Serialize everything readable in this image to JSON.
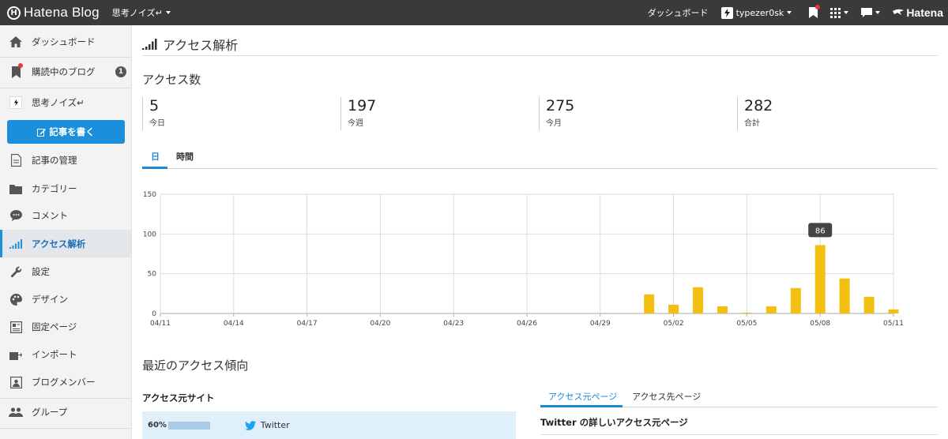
{
  "topbar": {
    "logo_text": "Hatena Blog",
    "logo_mark": "H",
    "blog_name": "思考ノイズ↵",
    "dashboard_label": "ダッシュボード",
    "user_name": "typezer0sk",
    "hatena_label": "Hatena"
  },
  "sidebar": {
    "items": [
      {
        "label": "ダッシュボード",
        "icon": "home-icon"
      },
      {
        "label": "購読中のブログ",
        "icon": "bookmark-icon",
        "badge": "1"
      },
      {
        "label": "思考ノイズ↵",
        "icon": "blog-icon"
      },
      {
        "label": "記事の管理",
        "icon": "document-icon"
      },
      {
        "label": "カテゴリー",
        "icon": "folder-icon"
      },
      {
        "label": "コメント",
        "icon": "comment-icon"
      },
      {
        "label": "アクセス解析",
        "icon": "signal-icon",
        "active": true
      },
      {
        "label": "設定",
        "icon": "wrench-icon"
      },
      {
        "label": "デザイン",
        "icon": "palette-icon"
      },
      {
        "label": "固定ページ",
        "icon": "page-icon"
      },
      {
        "label": "インポート",
        "icon": "import-icon"
      },
      {
        "label": "ブログメンバー",
        "icon": "member-icon"
      },
      {
        "label": "グループ",
        "icon": "group-icon"
      }
    ],
    "write_button": "記事を書く"
  },
  "main": {
    "page_title": "アクセス解析",
    "access_count_title": "アクセス数",
    "stats": [
      {
        "value": "5",
        "label": "今日"
      },
      {
        "value": "197",
        "label": "今週"
      },
      {
        "value": "275",
        "label": "今月"
      },
      {
        "value": "282",
        "label": "合計"
      }
    ],
    "tabs": [
      {
        "label": "日",
        "active": true
      },
      {
        "label": "時間",
        "active": false
      }
    ],
    "trend_title": "最近のアクセス傾向",
    "source_sites_title": "アクセス元サイト",
    "source_row": {
      "percent": "60%",
      "percent_value": 60,
      "name": "Twitter"
    },
    "right_tabs": [
      {
        "label": "アクセス元ページ",
        "active": true
      },
      {
        "label": "アクセス先ページ",
        "active": false
      }
    ],
    "twitter_pages_title": "Twitter の詳しいアクセス元ページ"
  },
  "chart_data": {
    "type": "bar",
    "ylim": [
      0,
      150
    ],
    "yticks": [
      0,
      50,
      100,
      150
    ],
    "xtick_labels": [
      "04/11",
      "04/14",
      "04/17",
      "04/20",
      "04/23",
      "04/26",
      "04/29",
      "05/02",
      "05/05",
      "05/08",
      "05/11"
    ],
    "dates": [
      "04/11",
      "04/12",
      "04/13",
      "04/14",
      "04/15",
      "04/16",
      "04/17",
      "04/18",
      "04/19",
      "04/20",
      "04/21",
      "04/22",
      "04/23",
      "04/24",
      "04/25",
      "04/26",
      "04/27",
      "04/28",
      "04/29",
      "04/30",
      "05/01",
      "05/02",
      "05/03",
      "05/04",
      "05/05",
      "05/06",
      "05/07",
      "05/08",
      "05/09",
      "05/10",
      "05/11"
    ],
    "values": [
      0,
      0,
      0,
      0,
      0,
      0,
      0,
      0,
      0,
      0,
      0,
      0,
      0,
      0,
      0,
      0,
      0,
      0,
      0,
      0,
      24,
      11,
      33,
      9,
      1,
      9,
      32,
      86,
      44,
      21,
      5
    ],
    "tooltip": {
      "label": "86"
    },
    "bar_color": "#f3bf10",
    "grid": true
  }
}
